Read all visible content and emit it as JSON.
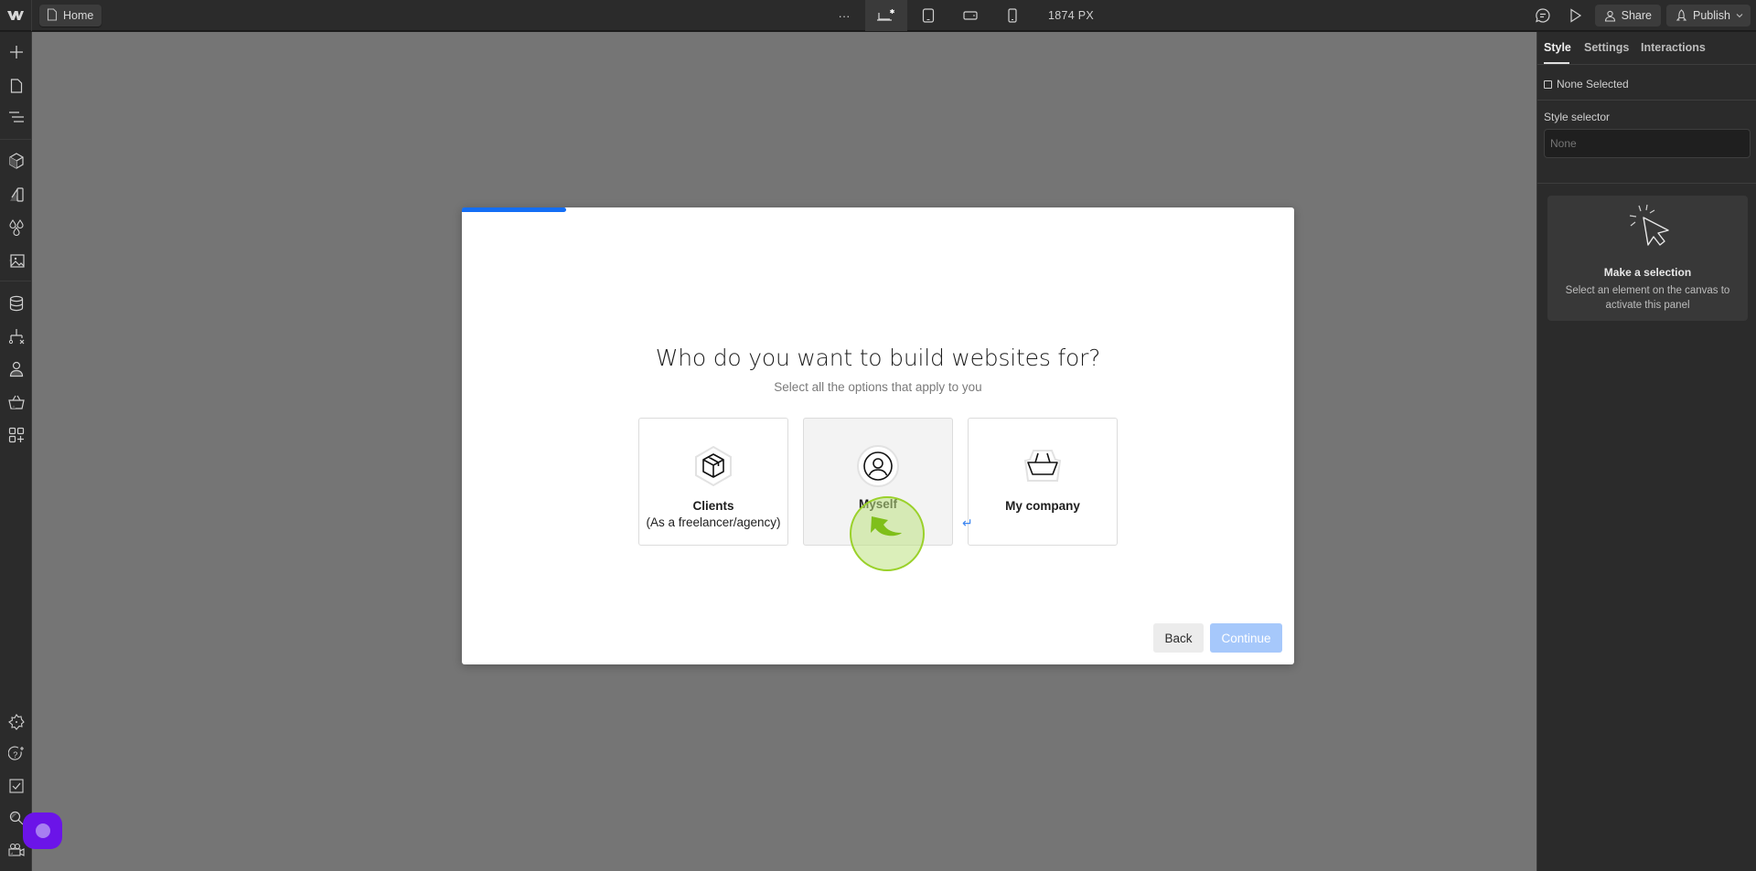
{
  "topbar": {
    "logo": "webflow-logo",
    "page_label": "Home",
    "more_label": "···",
    "breakpoints": [
      {
        "name": "desktop-base",
        "active": true
      },
      {
        "name": "tablet",
        "active": false
      },
      {
        "name": "mobile-landscape",
        "active": false
      },
      {
        "name": "mobile-portrait",
        "active": false
      }
    ],
    "width_readout": "1874 PX",
    "share_label": "Share",
    "publish_label": "Publish"
  },
  "leftbar": {
    "items": [
      "add",
      "pages",
      "navigator",
      "components",
      "style-selectors",
      "variables",
      "assets",
      "cms",
      "logic",
      "users",
      "ecommerce",
      "apps"
    ],
    "bottom_items": [
      "settings",
      "help",
      "audit",
      "search",
      "video"
    ]
  },
  "modal": {
    "progress": 0.125,
    "title": "Who do you want to build websites for?",
    "subtitle": "Select all the options that apply to you",
    "options": [
      {
        "label": "Clients",
        "sublabel": "(As a freelancer/agency)",
        "icon": "box-icon",
        "hovered": false
      },
      {
        "label": "Myself",
        "sublabel": "",
        "icon": "user-icon",
        "hovered": true
      },
      {
        "label": "My company",
        "sublabel": "",
        "icon": "basket-icon",
        "hovered": false
      }
    ],
    "back_label": "Back",
    "continue_label": "Continue",
    "return_glyph": "↵"
  },
  "right_panel": {
    "tabs": [
      "Style",
      "Settings",
      "Interactions"
    ],
    "active_tab": "Style",
    "none_selected": "None Selected",
    "style_selector_label": "Style selector",
    "style_selector_placeholder": "None",
    "empty_title": "Make a selection",
    "empty_desc": "Select an element on the canvas to activate this panel"
  },
  "colors": {
    "accent": "#146ef5",
    "continue_disabled": "#a6c8fb",
    "help_bubble": "#6b14e8",
    "click_marker": "#9ad12a"
  }
}
